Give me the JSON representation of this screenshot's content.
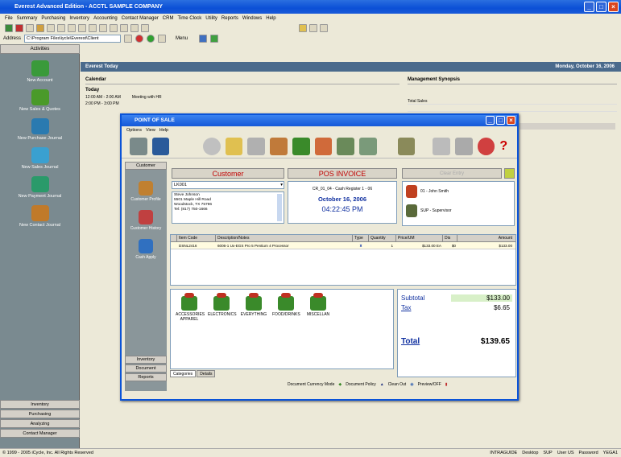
{
  "window": {
    "title": "Everest Advanced Edition - ACCTL SAMPLE COMPANY"
  },
  "menu": [
    "File",
    "Summary",
    "Purchasing",
    "Inventory",
    "Accounting",
    "Contact Manager",
    "CRM",
    "Time Clock",
    "Utility",
    "Reports",
    "Windows",
    "Help"
  ],
  "address": {
    "label": "Address",
    "value": "C:\\Program Files\\iycle\\Everest\\Client"
  },
  "toolbar2": {
    "menu_label": "Menu"
  },
  "sidebar": {
    "header": "Activities",
    "items": [
      {
        "label": "New Account",
        "color": "#3a9a3a"
      },
      {
        "label": "New Sales & Quotes",
        "color": "#4a9a2a"
      },
      {
        "label": "New Purchase Journal",
        "color": "#2a7ab0"
      },
      {
        "label": "New Sales Journal",
        "color": "#3aa0d0"
      },
      {
        "label": "New Payment Journal",
        "color": "#2a9a6a"
      },
      {
        "label": "New Contact Journal",
        "color": "#c07a2a"
      }
    ],
    "bottom": [
      "Inventory",
      "Purchasing",
      "Analyzing",
      "Contact Manager"
    ]
  },
  "main": {
    "header": "Everest Today",
    "date": "Monday, October 16, 2006",
    "calendar_title": "Calendar",
    "today_label": "Today",
    "appointments": [
      {
        "time": "12:00 AM - 2:00 AM",
        "text": "Meeting with HR"
      },
      {
        "time": "2:00 PM - 3:00 PM",
        "text": ""
      }
    ],
    "mgmt_title": "Management Synopsis",
    "mgmt_rows": [
      "Total Sales",
      ""
    ]
  },
  "pos": {
    "title": "POINT OF SALE",
    "menu": [
      "Options",
      "View",
      "Help"
    ],
    "left": {
      "top_section": "Customer",
      "items": [
        "Customer Profile",
        "Customer History",
        "Cash Apply"
      ],
      "bottom_sections": [
        "Inventory",
        "Document",
        "Reports"
      ]
    },
    "customer_label": "Customer",
    "customer_id": "LK001",
    "customer_address": [
      "Steve Johnson",
      "5501 Maple Hill Road",
      "Woodstock, TX 75796",
      "Tel: (817) 750-1666"
    ],
    "invoice_label": "POS INVOICE",
    "invoice_number": "CR_01_04 - Cash Register 1 - 06",
    "invoice_date": "October 16, 2006",
    "invoice_time": "04:22:45 PM",
    "clear_button": "Clear Entry",
    "staff": [
      {
        "label": "01 - John Smith"
      },
      {
        "label": "SUP - Supervisor"
      }
    ],
    "grid_headers": [
      "",
      "Item Code",
      "Description/Notes",
      "Type",
      "Quantity",
      "Price/UM",
      "Dis",
      "Amount"
    ],
    "grid_rows": [
      {
        "code": "DSNL2416",
        "desc": "6006-1 Ux-EGS Pro 5 Pentium 4 Processor",
        "qty": "1",
        "price": "$133.00 EA",
        "dis": "$0",
        "amount": "$133.00"
      }
    ],
    "categories": [
      "ACCESSORIES APPAREL",
      "ELECTRONICS",
      "EVERYTHING",
      "FOOD/DRINKS",
      "MISCELLAN"
    ],
    "tabs": [
      "Categories",
      "Details"
    ],
    "subtotal_label": "Subtotal",
    "subtotal_value": "$133.00",
    "tax_label": "Tax",
    "tax_value": "$6.65",
    "total_label": "Total",
    "total_value": "$139.65",
    "footer_buttons": [
      "Document Currency Mode",
      "Document Policy",
      "Clean Out",
      "Preview/OFF"
    ]
  },
  "status": {
    "copyright": "© 1999 - 2005 iCycle, Inc. All Rights Reserved",
    "right": [
      "INTRAGUIDE",
      "Desktop",
      "SUP",
      "User US",
      "Password",
      "YEGA1"
    ]
  },
  "colors": {
    "title_blue": "#0b4fd6",
    "sidebar": "#7a8a90",
    "pos_red": "#c00000"
  }
}
